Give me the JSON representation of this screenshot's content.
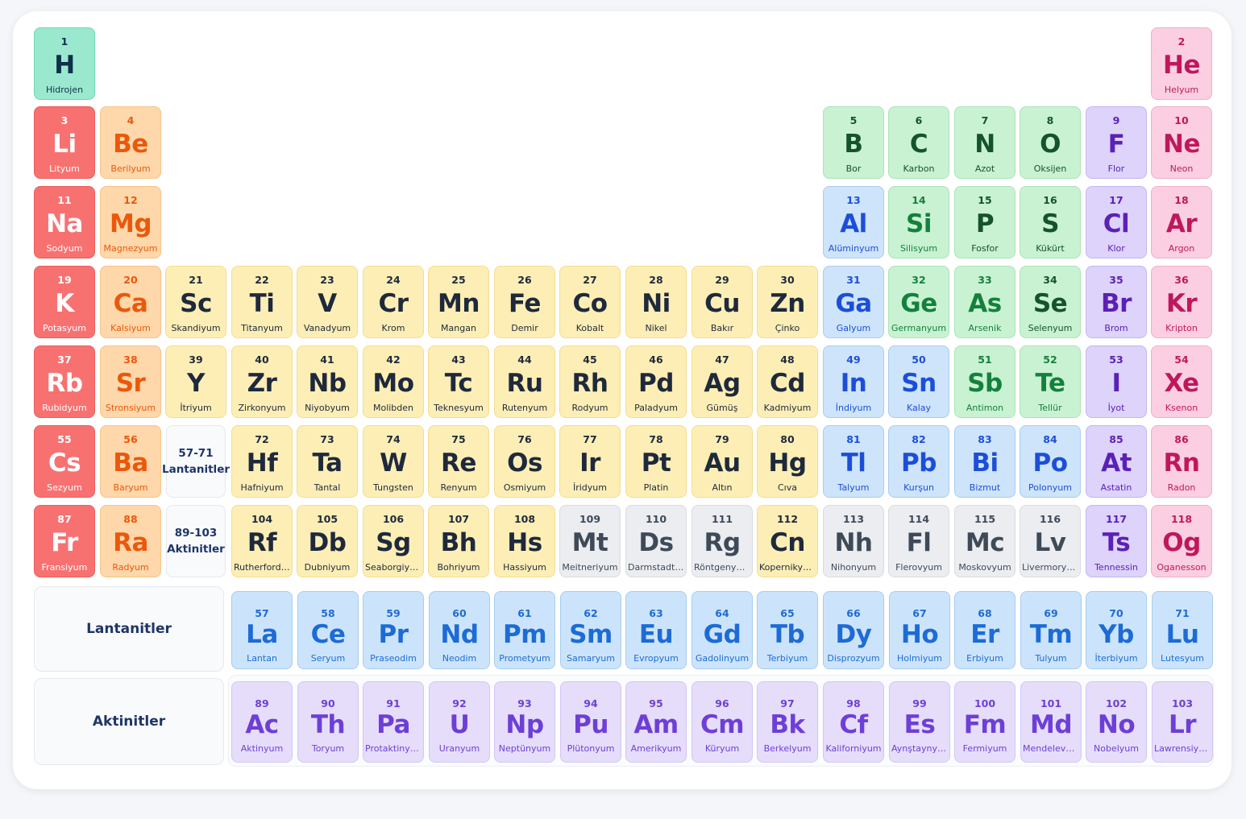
{
  "placeholders": {
    "lanthanides_range": "57-71",
    "lanthanides_label": "Lantanitler",
    "actinides_range": "89-103",
    "actinides_label": "Aktinitler"
  },
  "f_block_labels": {
    "lanthanides": "Lantanitler",
    "actinides": "Aktinitler"
  },
  "category_colors": {
    "alkali": "#f87171",
    "alkaline": "#fed7aa",
    "transition": "#fdeeb6",
    "unknown": "#ebedf0",
    "metalloid": "#c9f2d2",
    "nonmetal-poly": "#c9f2d2",
    "post": "#cde4fb",
    "halogen": "#ddd3fb",
    "noble": "#fbcfe1",
    "hydrogen": "#9ae9cf",
    "lanthanide": "#cce4fb",
    "actinide": "#e6ddfb"
  },
  "elements": [
    {
      "n": 1,
      "s": "H",
      "name": "Hidrojen",
      "p": 1,
      "g": 1,
      "cat": "hydrogen"
    },
    {
      "n": 2,
      "s": "He",
      "name": "Helyum",
      "p": 1,
      "g": 18,
      "cat": "noble"
    },
    {
      "n": 3,
      "s": "Li",
      "name": "Lityum",
      "p": 2,
      "g": 1,
      "cat": "alkali"
    },
    {
      "n": 4,
      "s": "Be",
      "name": "Berilyum",
      "p": 2,
      "g": 2,
      "cat": "alkaline"
    },
    {
      "n": 5,
      "s": "B",
      "name": "Bor",
      "p": 2,
      "g": 13,
      "cat": "nonmetal-poly"
    },
    {
      "n": 6,
      "s": "C",
      "name": "Karbon",
      "p": 2,
      "g": 14,
      "cat": "nonmetal-poly"
    },
    {
      "n": 7,
      "s": "N",
      "name": "Azot",
      "p": 2,
      "g": 15,
      "cat": "nonmetal-poly"
    },
    {
      "n": 8,
      "s": "O",
      "name": "Oksijen",
      "p": 2,
      "g": 16,
      "cat": "nonmetal-poly"
    },
    {
      "n": 9,
      "s": "F",
      "name": "Flor",
      "p": 2,
      "g": 17,
      "cat": "halogen"
    },
    {
      "n": 10,
      "s": "Ne",
      "name": "Neon",
      "p": 2,
      "g": 18,
      "cat": "noble"
    },
    {
      "n": 11,
      "s": "Na",
      "name": "Sodyum",
      "p": 3,
      "g": 1,
      "cat": "alkali"
    },
    {
      "n": 12,
      "s": "Mg",
      "name": "Magnezyum",
      "p": 3,
      "g": 2,
      "cat": "alkaline"
    },
    {
      "n": 13,
      "s": "Al",
      "name": "Alüminyum",
      "p": 3,
      "g": 13,
      "cat": "post"
    },
    {
      "n": 14,
      "s": "Si",
      "name": "Silisyum",
      "p": 3,
      "g": 14,
      "cat": "metalloid"
    },
    {
      "n": 15,
      "s": "P",
      "name": "Fosfor",
      "p": 3,
      "g": 15,
      "cat": "nonmetal-poly"
    },
    {
      "n": 16,
      "s": "S",
      "name": "Kükürt",
      "p": 3,
      "g": 16,
      "cat": "nonmetal-poly"
    },
    {
      "n": 17,
      "s": "Cl",
      "name": "Klor",
      "p": 3,
      "g": 17,
      "cat": "halogen"
    },
    {
      "n": 18,
      "s": "Ar",
      "name": "Argon",
      "p": 3,
      "g": 18,
      "cat": "noble"
    },
    {
      "n": 19,
      "s": "K",
      "name": "Potasyum",
      "p": 4,
      "g": 1,
      "cat": "alkali"
    },
    {
      "n": 20,
      "s": "Ca",
      "name": "Kalsiyum",
      "p": 4,
      "g": 2,
      "cat": "alkaline"
    },
    {
      "n": 21,
      "s": "Sc",
      "name": "Skandiyum",
      "p": 4,
      "g": 3,
      "cat": "transition"
    },
    {
      "n": 22,
      "s": "Ti",
      "name": "Titanyum",
      "p": 4,
      "g": 4,
      "cat": "transition"
    },
    {
      "n": 23,
      "s": "V",
      "name": "Vanadyum",
      "p": 4,
      "g": 5,
      "cat": "transition"
    },
    {
      "n": 24,
      "s": "Cr",
      "name": "Krom",
      "p": 4,
      "g": 6,
      "cat": "transition"
    },
    {
      "n": 25,
      "s": "Mn",
      "name": "Mangan",
      "p": 4,
      "g": 7,
      "cat": "transition"
    },
    {
      "n": 26,
      "s": "Fe",
      "name": "Demir",
      "p": 4,
      "g": 8,
      "cat": "transition"
    },
    {
      "n": 27,
      "s": "Co",
      "name": "Kobalt",
      "p": 4,
      "g": 9,
      "cat": "transition"
    },
    {
      "n": 28,
      "s": "Ni",
      "name": "Nikel",
      "p": 4,
      "g": 10,
      "cat": "transition"
    },
    {
      "n": 29,
      "s": "Cu",
      "name": "Bakır",
      "p": 4,
      "g": 11,
      "cat": "transition"
    },
    {
      "n": 30,
      "s": "Zn",
      "name": "Çinko",
      "p": 4,
      "g": 12,
      "cat": "transition"
    },
    {
      "n": 31,
      "s": "Ga",
      "name": "Galyum",
      "p": 4,
      "g": 13,
      "cat": "post"
    },
    {
      "n": 32,
      "s": "Ge",
      "name": "Germanyum",
      "p": 4,
      "g": 14,
      "cat": "metalloid"
    },
    {
      "n": 33,
      "s": "As",
      "name": "Arsenik",
      "p": 4,
      "g": 15,
      "cat": "metalloid"
    },
    {
      "n": 34,
      "s": "Se",
      "name": "Selenyum",
      "p": 4,
      "g": 16,
      "cat": "nonmetal-poly"
    },
    {
      "n": 35,
      "s": "Br",
      "name": "Brom",
      "p": 4,
      "g": 17,
      "cat": "halogen"
    },
    {
      "n": 36,
      "s": "Kr",
      "name": "Kripton",
      "p": 4,
      "g": 18,
      "cat": "noble"
    },
    {
      "n": 37,
      "s": "Rb",
      "name": "Rubidyum",
      "p": 5,
      "g": 1,
      "cat": "alkali"
    },
    {
      "n": 38,
      "s": "Sr",
      "name": "Stronsiyum",
      "p": 5,
      "g": 2,
      "cat": "alkaline"
    },
    {
      "n": 39,
      "s": "Y",
      "name": "İtriyum",
      "p": 5,
      "g": 3,
      "cat": "transition"
    },
    {
      "n": 40,
      "s": "Zr",
      "name": "Zirkonyum",
      "p": 5,
      "g": 4,
      "cat": "transition"
    },
    {
      "n": 41,
      "s": "Nb",
      "name": "Niyobyum",
      "p": 5,
      "g": 5,
      "cat": "transition"
    },
    {
      "n": 42,
      "s": "Mo",
      "name": "Molibden",
      "p": 5,
      "g": 6,
      "cat": "transition"
    },
    {
      "n": 43,
      "s": "Tc",
      "name": "Teknesyum",
      "p": 5,
      "g": 7,
      "cat": "transition"
    },
    {
      "n": 44,
      "s": "Ru",
      "name": "Rutenyum",
      "p": 5,
      "g": 8,
      "cat": "transition"
    },
    {
      "n": 45,
      "s": "Rh",
      "name": "Rodyum",
      "p": 5,
      "g": 9,
      "cat": "transition"
    },
    {
      "n": 46,
      "s": "Pd",
      "name": "Paladyum",
      "p": 5,
      "g": 10,
      "cat": "transition"
    },
    {
      "n": 47,
      "s": "Ag",
      "name": "Gümüş",
      "p": 5,
      "g": 11,
      "cat": "transition"
    },
    {
      "n": 48,
      "s": "Cd",
      "name": "Kadmiyum",
      "p": 5,
      "g": 12,
      "cat": "transition"
    },
    {
      "n": 49,
      "s": "In",
      "name": "İndiyum",
      "p": 5,
      "g": 13,
      "cat": "post"
    },
    {
      "n": 50,
      "s": "Sn",
      "name": "Kalay",
      "p": 5,
      "g": 14,
      "cat": "post"
    },
    {
      "n": 51,
      "s": "Sb",
      "name": "Antimon",
      "p": 5,
      "g": 15,
      "cat": "metalloid"
    },
    {
      "n": 52,
      "s": "Te",
      "name": "Tellür",
      "p": 5,
      "g": 16,
      "cat": "metalloid"
    },
    {
      "n": 53,
      "s": "I",
      "name": "İyot",
      "p": 5,
      "g": 17,
      "cat": "halogen"
    },
    {
      "n": 54,
      "s": "Xe",
      "name": "Ksenon",
      "p": 5,
      "g": 18,
      "cat": "noble"
    },
    {
      "n": 55,
      "s": "Cs",
      "name": "Sezyum",
      "p": 6,
      "g": 1,
      "cat": "alkali"
    },
    {
      "n": 56,
      "s": "Ba",
      "name": "Baryum",
      "p": 6,
      "g": 2,
      "cat": "alkaline"
    },
    {
      "n": 72,
      "s": "Hf",
      "name": "Hafniyum",
      "p": 6,
      "g": 4,
      "cat": "transition"
    },
    {
      "n": 73,
      "s": "Ta",
      "name": "Tantal",
      "p": 6,
      "g": 5,
      "cat": "transition"
    },
    {
      "n": 74,
      "s": "W",
      "name": "Tungsten",
      "p": 6,
      "g": 6,
      "cat": "transition"
    },
    {
      "n": 75,
      "s": "Re",
      "name": "Renyum",
      "p": 6,
      "g": 7,
      "cat": "transition"
    },
    {
      "n": 76,
      "s": "Os",
      "name": "Osmiyum",
      "p": 6,
      "g": 8,
      "cat": "transition"
    },
    {
      "n": 77,
      "s": "Ir",
      "name": "İridyum",
      "p": 6,
      "g": 9,
      "cat": "transition"
    },
    {
      "n": 78,
      "s": "Pt",
      "name": "Platin",
      "p": 6,
      "g": 10,
      "cat": "transition"
    },
    {
      "n": 79,
      "s": "Au",
      "name": "Altın",
      "p": 6,
      "g": 11,
      "cat": "transition"
    },
    {
      "n": 80,
      "s": "Hg",
      "name": "Cıva",
      "p": 6,
      "g": 12,
      "cat": "transition"
    },
    {
      "n": 81,
      "s": "Tl",
      "name": "Talyum",
      "p": 6,
      "g": 13,
      "cat": "post"
    },
    {
      "n": 82,
      "s": "Pb",
      "name": "Kurşun",
      "p": 6,
      "g": 14,
      "cat": "post"
    },
    {
      "n": 83,
      "s": "Bi",
      "name": "Bizmut",
      "p": 6,
      "g": 15,
      "cat": "post"
    },
    {
      "n": 84,
      "s": "Po",
      "name": "Polonyum",
      "p": 6,
      "g": 16,
      "cat": "post"
    },
    {
      "n": 85,
      "s": "At",
      "name": "Astatin",
      "p": 6,
      "g": 17,
      "cat": "halogen"
    },
    {
      "n": 86,
      "s": "Rn",
      "name": "Radon",
      "p": 6,
      "g": 18,
      "cat": "noble"
    },
    {
      "n": 87,
      "s": "Fr",
      "name": "Fransiyum",
      "p": 7,
      "g": 1,
      "cat": "alkali"
    },
    {
      "n": 88,
      "s": "Ra",
      "name": "Radyum",
      "p": 7,
      "g": 2,
      "cat": "alkaline"
    },
    {
      "n": 104,
      "s": "Rf",
      "name": "Rutherfordiyum",
      "p": 7,
      "g": 4,
      "cat": "transition"
    },
    {
      "n": 105,
      "s": "Db",
      "name": "Dubniyum",
      "p": 7,
      "g": 5,
      "cat": "transition"
    },
    {
      "n": 106,
      "s": "Sg",
      "name": "Seaborgiyum",
      "p": 7,
      "g": 6,
      "cat": "transition"
    },
    {
      "n": 107,
      "s": "Bh",
      "name": "Bohriyum",
      "p": 7,
      "g": 7,
      "cat": "transition"
    },
    {
      "n": 108,
      "s": "Hs",
      "name": "Hassiyum",
      "p": 7,
      "g": 8,
      "cat": "transition"
    },
    {
      "n": 109,
      "s": "Mt",
      "name": "Meitneriyum",
      "p": 7,
      "g": 9,
      "cat": "unknown"
    },
    {
      "n": 110,
      "s": "Ds",
      "name": "Darmstadtiyum",
      "p": 7,
      "g": 10,
      "cat": "unknown"
    },
    {
      "n": 111,
      "s": "Rg",
      "name": "Röntgenyum",
      "p": 7,
      "g": 11,
      "cat": "unknown"
    },
    {
      "n": 112,
      "s": "Cn",
      "name": "Kopernikyum",
      "p": 7,
      "g": 12,
      "cat": "transition"
    },
    {
      "n": 113,
      "s": "Nh",
      "name": "Nihonyum",
      "p": 7,
      "g": 13,
      "cat": "unknown"
    },
    {
      "n": 114,
      "s": "Fl",
      "name": "Flerovyum",
      "p": 7,
      "g": 14,
      "cat": "unknown"
    },
    {
      "n": 115,
      "s": "Mc",
      "name": "Moskovyum",
      "p": 7,
      "g": 15,
      "cat": "unknown"
    },
    {
      "n": 116,
      "s": "Lv",
      "name": "Livermoryum",
      "p": 7,
      "g": 16,
      "cat": "unknown"
    },
    {
      "n": 117,
      "s": "Ts",
      "name": "Tennessin",
      "p": 7,
      "g": 17,
      "cat": "halogen"
    },
    {
      "n": 118,
      "s": "Og",
      "name": "Oganesson",
      "p": 7,
      "g": 18,
      "cat": "noble"
    }
  ],
  "lanthanides": [
    {
      "n": 57,
      "s": "La",
      "name": "Lantan"
    },
    {
      "n": 58,
      "s": "Ce",
      "name": "Seryum"
    },
    {
      "n": 59,
      "s": "Pr",
      "name": "Praseodim"
    },
    {
      "n": 60,
      "s": "Nd",
      "name": "Neodim"
    },
    {
      "n": 61,
      "s": "Pm",
      "name": "Prometyum"
    },
    {
      "n": 62,
      "s": "Sm",
      "name": "Samaryum"
    },
    {
      "n": 63,
      "s": "Eu",
      "name": "Evropyum"
    },
    {
      "n": 64,
      "s": "Gd",
      "name": "Gadolinyum"
    },
    {
      "n": 65,
      "s": "Tb",
      "name": "Terbiyum"
    },
    {
      "n": 66,
      "s": "Dy",
      "name": "Disprozyum"
    },
    {
      "n": 67,
      "s": "Ho",
      "name": "Holmiyum"
    },
    {
      "n": 68,
      "s": "Er",
      "name": "Erbiyum"
    },
    {
      "n": 69,
      "s": "Tm",
      "name": "Tulyum"
    },
    {
      "n": 70,
      "s": "Yb",
      "name": "İterbiyum"
    },
    {
      "n": 71,
      "s": "Lu",
      "name": "Lutesyum"
    }
  ],
  "actinides": [
    {
      "n": 89,
      "s": "Ac",
      "name": "Aktinyum"
    },
    {
      "n": 90,
      "s": "Th",
      "name": "Toryum"
    },
    {
      "n": 91,
      "s": "Pa",
      "name": "Protaktinyum"
    },
    {
      "n": 92,
      "s": "U",
      "name": "Uranyum"
    },
    {
      "n": 93,
      "s": "Np",
      "name": "Neptünyum"
    },
    {
      "n": 94,
      "s": "Pu",
      "name": "Plütonyum"
    },
    {
      "n": 95,
      "s": "Am",
      "name": "Amerikyum"
    },
    {
      "n": 96,
      "s": "Cm",
      "name": "Küryum"
    },
    {
      "n": 97,
      "s": "Bk",
      "name": "Berkelyum"
    },
    {
      "n": 98,
      "s": "Cf",
      "name": "Kaliforniyum"
    },
    {
      "n": 99,
      "s": "Es",
      "name": "Aynştaynyum"
    },
    {
      "n": 100,
      "s": "Fm",
      "name": "Fermiyum"
    },
    {
      "n": 101,
      "s": "Md",
      "name": "Mendelevyum"
    },
    {
      "n": 102,
      "s": "No",
      "name": "Nobelyum"
    },
    {
      "n": 103,
      "s": "Lr",
      "name": "Lawrensiyum"
    }
  ]
}
